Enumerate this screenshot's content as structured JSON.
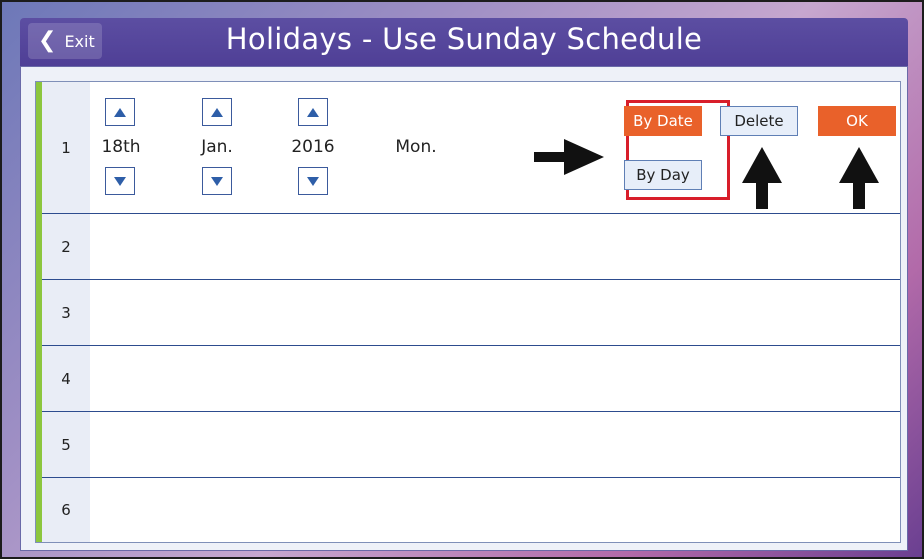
{
  "header": {
    "exit_label": "Exit",
    "title": "Holidays - Use Sunday Schedule"
  },
  "rows": [
    {
      "num": "1",
      "day": "18th",
      "month": "Jan.",
      "year": "2016",
      "weekday": "Mon."
    },
    {
      "num": "2"
    },
    {
      "num": "3"
    },
    {
      "num": "4"
    },
    {
      "num": "5"
    },
    {
      "num": "6"
    }
  ],
  "buttons": {
    "by_date": "By Date",
    "by_day": "By Day",
    "delete": "Delete",
    "ok": "OK"
  },
  "colors": {
    "accent_orange": "#e9612a",
    "title_bar": "#5c4ea2",
    "row_marker": "#8cc63e",
    "highlight_box": "#d81e2a"
  }
}
